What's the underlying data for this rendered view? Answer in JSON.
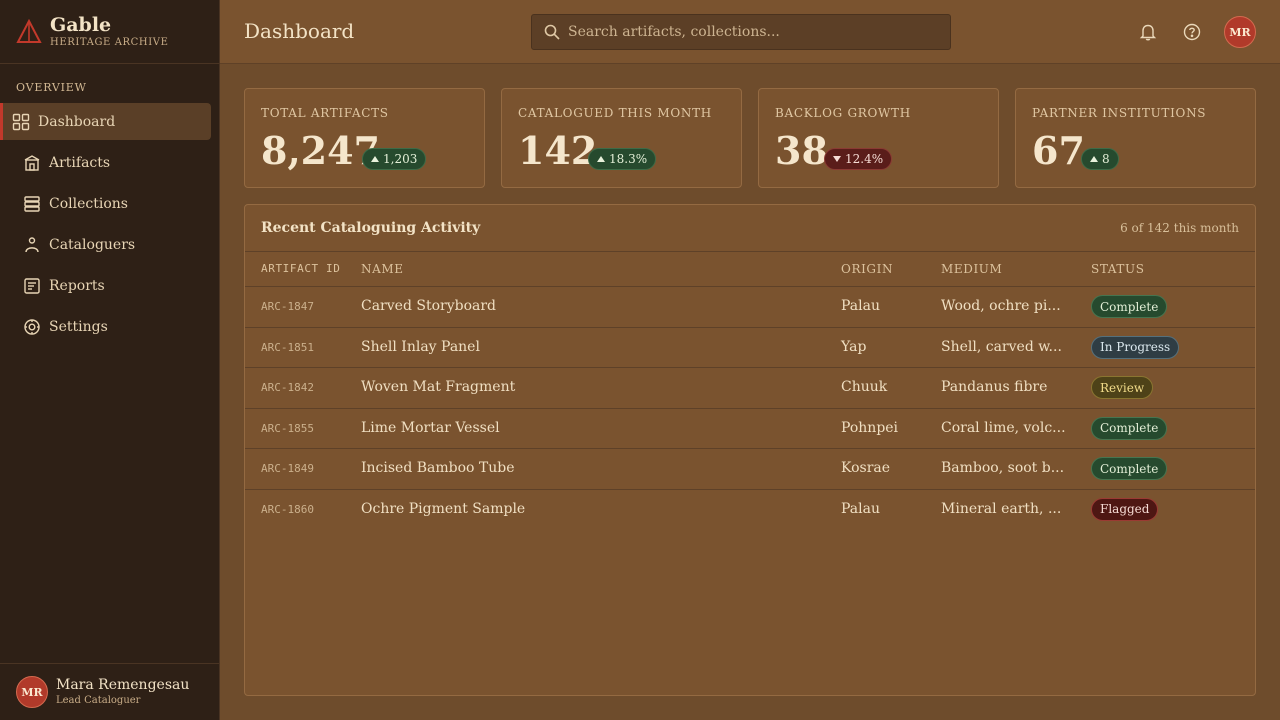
{
  "brand": {
    "name": "Gable",
    "subtitle": "HERITAGE ARCHIVE"
  },
  "sidebar": {
    "section_label": "OVERVIEW",
    "items": [
      {
        "label": "Dashboard",
        "icon": "grid-icon",
        "active": true
      },
      {
        "label": "Artifacts",
        "icon": "museum-icon"
      },
      {
        "label": "Collections",
        "icon": "stack-icon"
      },
      {
        "label": "Cataloguers",
        "icon": "person-icon"
      },
      {
        "label": "Reports",
        "icon": "report-icon"
      },
      {
        "label": "Settings",
        "icon": "gear-icon"
      }
    ],
    "user": {
      "initials": "MR",
      "name": "Mara Remengesau",
      "role": "Lead Cataloguer"
    }
  },
  "header": {
    "title": "Dashboard",
    "search_placeholder": "Search artifacts, collections...",
    "avatar_initials": "MR"
  },
  "stats": [
    {
      "label": "TOTAL ARTIFACTS",
      "value": "8,247",
      "delta": "1,203",
      "direction": "up"
    },
    {
      "label": "CATALOGUED THIS MONTH",
      "value": "142",
      "delta": "18.3%",
      "direction": "up"
    },
    {
      "label": "BACKLOG GROWTH",
      "value": "38",
      "delta": "12.4%",
      "direction": "down"
    },
    {
      "label": "PARTNER INSTITUTIONS",
      "value": "67",
      "delta": "8",
      "direction": "up"
    }
  ],
  "activity": {
    "title": "Recent Cataloguing Activity",
    "meta": "6 of 142 this month",
    "columns": {
      "id": "ARTIFACT ID",
      "name": "NAME",
      "origin": "ORIGIN",
      "medium": "MEDIUM",
      "status": "STATUS"
    },
    "rows": [
      {
        "id": "ARC-1847",
        "name": "Carved Storyboard",
        "origin": "Palau",
        "medium": "Wood, ochre pi...",
        "status": "Complete",
        "status_kind": "complete"
      },
      {
        "id": "ARC-1851",
        "name": "Shell Inlay Panel",
        "origin": "Yap",
        "medium": "Shell, carved w...",
        "status": "In Progress",
        "status_kind": "progress"
      },
      {
        "id": "ARC-1842",
        "name": "Woven Mat Fragment",
        "origin": "Chuuk",
        "medium": "Pandanus fibre",
        "status": "Review",
        "status_kind": "review"
      },
      {
        "id": "ARC-1855",
        "name": "Lime Mortar Vessel",
        "origin": "Pohnpei",
        "medium": "Coral lime, volc...",
        "status": "Complete",
        "status_kind": "complete"
      },
      {
        "id": "ARC-1849",
        "name": "Incised Bamboo Tube",
        "origin": "Kosrae",
        "medium": "Bamboo, soot b...",
        "status": "Complete",
        "status_kind": "complete"
      },
      {
        "id": "ARC-1860",
        "name": "Ochre Pigment Sample",
        "origin": "Palau",
        "medium": "Mineral earth, ...",
        "status": "Flagged",
        "status_kind": "flagged"
      }
    ]
  }
}
